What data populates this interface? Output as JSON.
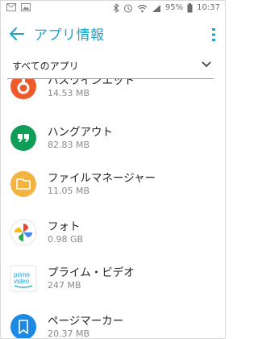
{
  "status_bar": {
    "battery": "95%",
    "time": "10:37"
  },
  "app_bar": {
    "title": "アプリ情報"
  },
  "filter": {
    "label": "すべてのアプリ"
  },
  "apps": [
    {
      "name": "ハスワインエット",
      "size": "14.53 MB",
      "icon": "red-app-icon",
      "color": "#ef5a2a"
    },
    {
      "name": "ハングアウト",
      "size": "82.83 MB",
      "icon": "hangouts-icon",
      "color": "#0f9d58"
    },
    {
      "name": "ファイルマネージャー",
      "size": "11.05 MB",
      "icon": "file-manager-icon",
      "color": "#f3b340"
    },
    {
      "name": "フォト",
      "size": "0.98 GB",
      "icon": "photos-icon",
      "color": "#ffffff"
    },
    {
      "name": "プライム・ビデオ",
      "size": "247 MB",
      "icon": "prime-video-icon",
      "color": "#ffffff"
    },
    {
      "name": "ページマーカー",
      "size": "20.37 MB",
      "icon": "page-marker-icon",
      "color": "#1e88e5"
    }
  ],
  "colors": {
    "accent": "#1fa4c9",
    "text_primary": "#222222",
    "text_secondary": "#8a8a8a"
  }
}
